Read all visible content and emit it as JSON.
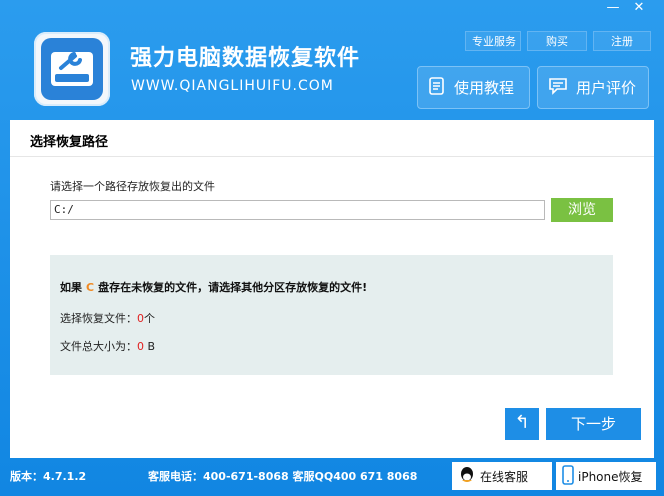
{
  "window": {
    "min_glyph": "—",
    "close_glyph": "✕"
  },
  "header": {
    "app_name": "强力电脑数据恢复软件",
    "url": "WWW.QIANGLIHUIFU.COM",
    "top_links": [
      "专业服务",
      "购买",
      "注册"
    ],
    "tutorial_label": "使用教程",
    "review_label": "用户评价"
  },
  "panel": {
    "title": "选择恢复路径",
    "prompt": "请选择一个路径存放恢复出的文件",
    "path_value": "C:/",
    "browse_label": "浏览",
    "warn_prefix": "如果",
    "warn_drive": "C",
    "warn_suffix": "盘存在未恢复的文件，请选择其他分区存放恢复的文件!",
    "files_label": "选择恢复文件：",
    "files_value": "0",
    "files_unit": "个",
    "size_label": "文件总大小为：",
    "size_value": "0",
    "size_unit": "B",
    "back_glyph": "↰",
    "next_label": "下一步"
  },
  "footer": {
    "version": "版本：4.7.1.2",
    "phone": "客服电话：400-671-8068 客服QQ400 671 8068",
    "online_label": "在线客服",
    "iphone_label": "iPhone恢复"
  },
  "colors": {
    "accent": "#1e8ee6",
    "browse": "#7ac142",
    "warn_drive": "#f08a24",
    "value_red": "#e02020"
  }
}
